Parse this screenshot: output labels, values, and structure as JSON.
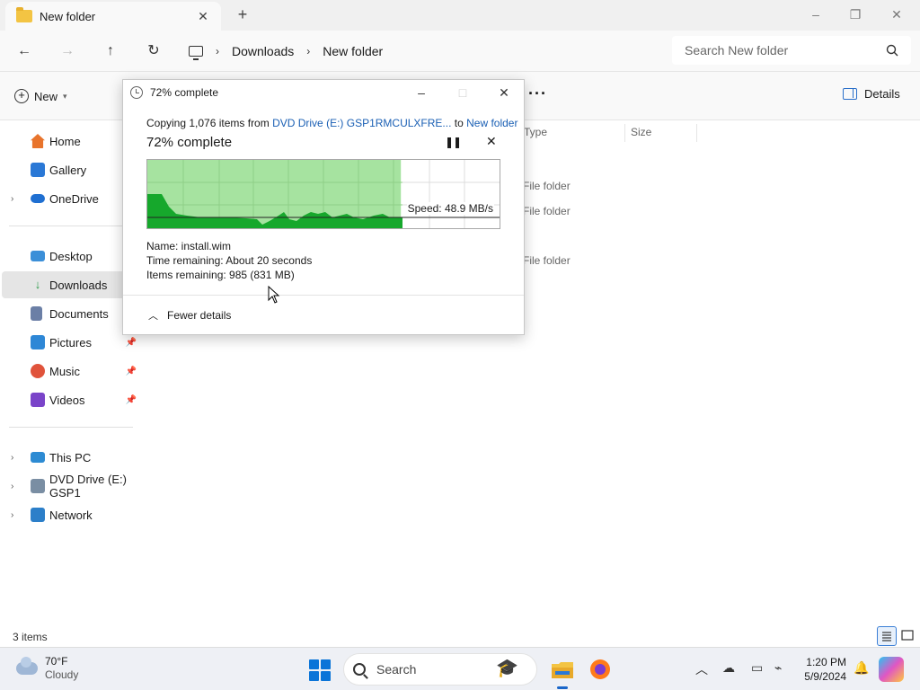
{
  "window": {
    "tab_title": "New folder",
    "new_tab": "+",
    "controls": [
      "–",
      "❐",
      "✕"
    ]
  },
  "nav": {
    "breadcrumbs": [
      "Downloads",
      "New folder"
    ],
    "search_placeholder": "Search New folder"
  },
  "commands": {
    "new_label": "New",
    "more": "···",
    "details_label": "Details"
  },
  "sidebar": {
    "items": [
      {
        "label": "Home",
        "icon": "home-icon",
        "color": "#e8742c"
      },
      {
        "label": "Gallery",
        "icon": "gallery-icon",
        "color": "#2a78d6"
      },
      {
        "label": "OneDrive",
        "icon": "onedrive-icon",
        "color": "#1f6fd1",
        "expandable": true
      },
      {
        "label": "Desktop",
        "icon": "desktop-icon",
        "color": "#3b8fd8"
      },
      {
        "label": "Downloads",
        "icon": "downloads-icon",
        "color": "#2c9a4a",
        "active": true
      },
      {
        "label": "Documents",
        "icon": "documents-icon",
        "color": "#6b7fa6"
      },
      {
        "label": "Pictures",
        "icon": "pictures-icon",
        "color": "#2e87d6",
        "pinned": true
      },
      {
        "label": "Music",
        "icon": "music-icon",
        "color": "#e0533b",
        "pinned": true
      },
      {
        "label": "Videos",
        "icon": "videos-icon",
        "color": "#7a44c9",
        "pinned": true
      },
      {
        "label": "This PC",
        "icon": "this-pc-icon",
        "color": "#2d8bd3",
        "expandable": true
      },
      {
        "label": "DVD Drive (E:) GSP1",
        "icon": "dvd-drive-icon",
        "color": "#7a8ea3",
        "expandable": true
      },
      {
        "label": "Network",
        "icon": "network-icon",
        "color": "#2c7fc9",
        "expandable": true
      }
    ]
  },
  "content": {
    "columns": [
      "Type",
      "Size"
    ],
    "rows": [
      {
        "type": "File folder"
      },
      {
        "type": "File folder"
      },
      {
        "type": "File folder"
      }
    ]
  },
  "statusbar": {
    "items_count": "3 items"
  },
  "dialog": {
    "title": "72% complete",
    "copy_prefix": "Copying 1,076 items from ",
    "source": "DVD Drive (E:) GSP1RMCULXFRE...",
    "to_word": " to ",
    "destination": "New folder",
    "percent_label": "72% complete",
    "progress": 0.72,
    "speed": "Speed: 48.9 MB/s",
    "name": "Name:  install.wim",
    "time_remaining": "Time remaining:  About 20 seconds",
    "items_remaining": "Items remaining:  985 (831 MB)",
    "fewer_details": "Fewer details",
    "progress_fill_color": "#a6e3a0",
    "speed_fill_color": "#16a82c"
  },
  "taskbar": {
    "temperature": "70°F",
    "condition": "Cloudy",
    "search_label": "Search",
    "time": "1:20 PM",
    "date": "5/9/2024"
  }
}
